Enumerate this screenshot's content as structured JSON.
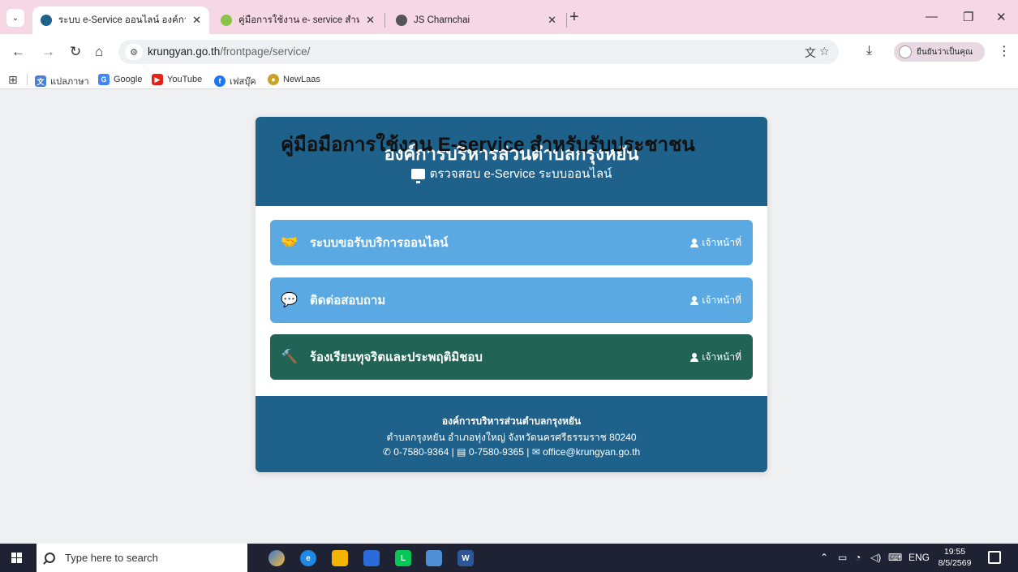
{
  "browser": {
    "tabs": [
      {
        "label": "ระบบ e-Service ออนไลน์ องค์การบริ",
        "active": true,
        "favicon_color": "#1e628c"
      },
      {
        "label": "คู่มือการใช้งาน e- service สำหรับประ",
        "active": false,
        "favicon_color": "#8bc34a"
      },
      {
        "label": "JS Charnchai",
        "active": false,
        "favicon_color": "#555555"
      }
    ],
    "tab_close": "✕",
    "new_tab": "+",
    "window_controls": {
      "minimize": "—",
      "restore": "❐",
      "close": "✕"
    },
    "url_host": "krungyan.go.th",
    "url_path": "/frontpage/service/",
    "profile_label": "ยืนยันว่าเป็นคุณ",
    "bookmarks": [
      {
        "label": "แปลภาษา",
        "icon": "translate-icon",
        "color": "#4a7fd4",
        "glyph": "文"
      },
      {
        "label": "Google",
        "icon": "google-icon",
        "color": "#4285f4",
        "glyph": "G"
      },
      {
        "label": "YouTube",
        "icon": "youtube-icon",
        "color": "#e62117",
        "glyph": "▶"
      },
      {
        "label": "เฟสบุ๊ค",
        "icon": "facebook-icon",
        "color": "#1877f2",
        "glyph": "f"
      },
      {
        "label": "NewLaas",
        "icon": "newlaas-icon",
        "color": "#c9a227",
        "glyph": "●"
      }
    ]
  },
  "page": {
    "overlay_title": "คู่มือมือการใช้งาน E-service สำหรับรับประชาชน",
    "org_title": "องค์การบริหารส่วนตำบลกรุงหยัน",
    "subtitle": "ตรวจสอบ e-Service ระบบออนไลน์",
    "services": [
      {
        "label": "ระบบขอรับบริการออนไลน์",
        "staff": "เจ้าหน้าที่",
        "icon": "handshake-icon",
        "glyph": "🤝",
        "color": "#5aa9e2"
      },
      {
        "label": "ติดต่อสอบถาม",
        "staff": "เจ้าหน้าที่",
        "icon": "comments-icon",
        "glyph": "💬",
        "color": "#5aa9e2"
      },
      {
        "label": "ร้องเรียนทุจริตและประพฤติมิชอบ",
        "staff": "เจ้าหน้าที่",
        "icon": "gavel-icon",
        "glyph": "🔨",
        "color": "#216455"
      }
    ],
    "footer": {
      "name": "องค์การบริหารส่วนตำบลกรุงหยัน",
      "address": "ตำบลกรุงหยัน อำเภอทุ่งใหญ่ จังหวัดนครศรีธรรมราช 80240",
      "phone": "0-7580-9364",
      "fax": "0-7580-9365",
      "email": "office@krungyan.go.th"
    }
  },
  "taskbar": {
    "search_placeholder": "Type here to search",
    "tray_lang": "ENG",
    "time": "19:55",
    "date": "8/5/2569"
  }
}
